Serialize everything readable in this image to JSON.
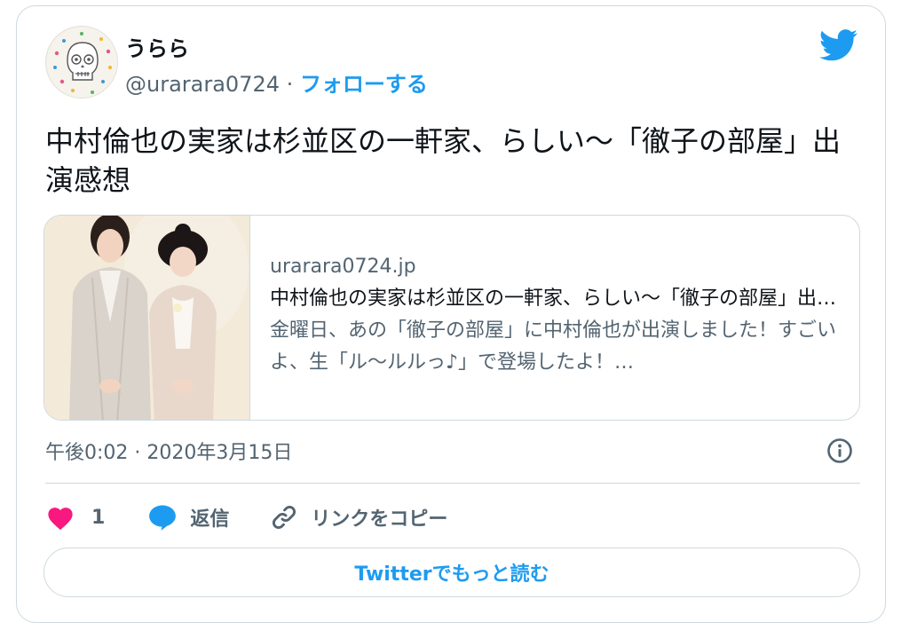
{
  "author": {
    "display_name": "うらら",
    "handle": "@urarara0724",
    "separator": "·",
    "follow_label": "フォローする",
    "avatar_icon": "skull-drawing-avatar"
  },
  "brand_icon": "twitter-bird-icon",
  "tweet": {
    "text": "中村倫也の実家は杉並区の一軒家、らしい〜「徹子の部屋」出演感想",
    "timestamp": "午後0:02 · 2020年3月15日"
  },
  "link_card": {
    "domain": "urarara0724.jp",
    "title": "中村倫也の実家は杉並区の一軒家、らしい〜「徹子の部屋」出演感想",
    "description": "金曜日、あの「徹子の部屋」に中村倫也が出演しました！すごいよ、生「ル〜ルルっ♪」で登場したよ！…",
    "thumbnail_icon": "two-people-photo"
  },
  "actions": {
    "like_count": "1",
    "reply_label": "返信",
    "copy_link_label": "リンクをコピー"
  },
  "more_button_label": "Twitterでもっと読む",
  "colors": {
    "accent": "#1d9bf0",
    "like": "#f91880",
    "text": "#0f1419",
    "secondary": "#536471",
    "border": "#cfd9de"
  }
}
